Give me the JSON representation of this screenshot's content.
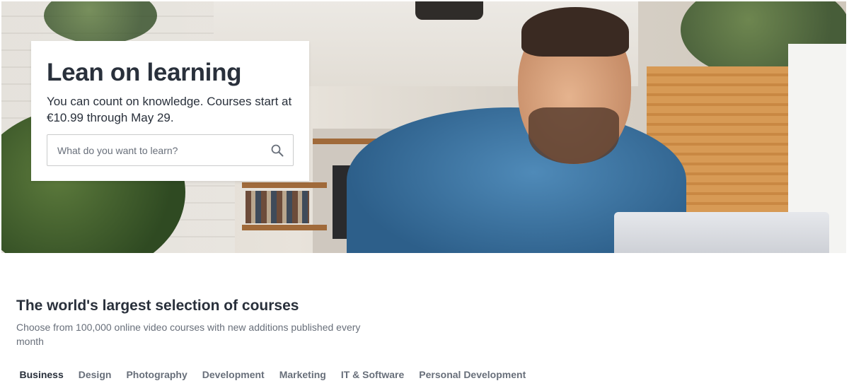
{
  "hero": {
    "title": "Lean on learning",
    "subtitle": "You can count on knowledge. Courses start at €10.99 through May 29.",
    "search": {
      "placeholder": "What do you want to learn?",
      "value": ""
    }
  },
  "section": {
    "title": "The world's largest selection of courses",
    "subtitle": "Choose from 100,000 online video courses with new additions published every month"
  },
  "tabs": [
    {
      "label": "Business",
      "active": true
    },
    {
      "label": "Design",
      "active": false
    },
    {
      "label": "Photography",
      "active": false
    },
    {
      "label": "Development",
      "active": false
    },
    {
      "label": "Marketing",
      "active": false
    },
    {
      "label": "IT & Software",
      "active": false
    },
    {
      "label": "Personal Development",
      "active": false
    }
  ],
  "icons": {
    "search": "search-icon"
  },
  "colors": {
    "text": "#29303b",
    "muted": "#686f7a",
    "border": "#cacbcc"
  }
}
